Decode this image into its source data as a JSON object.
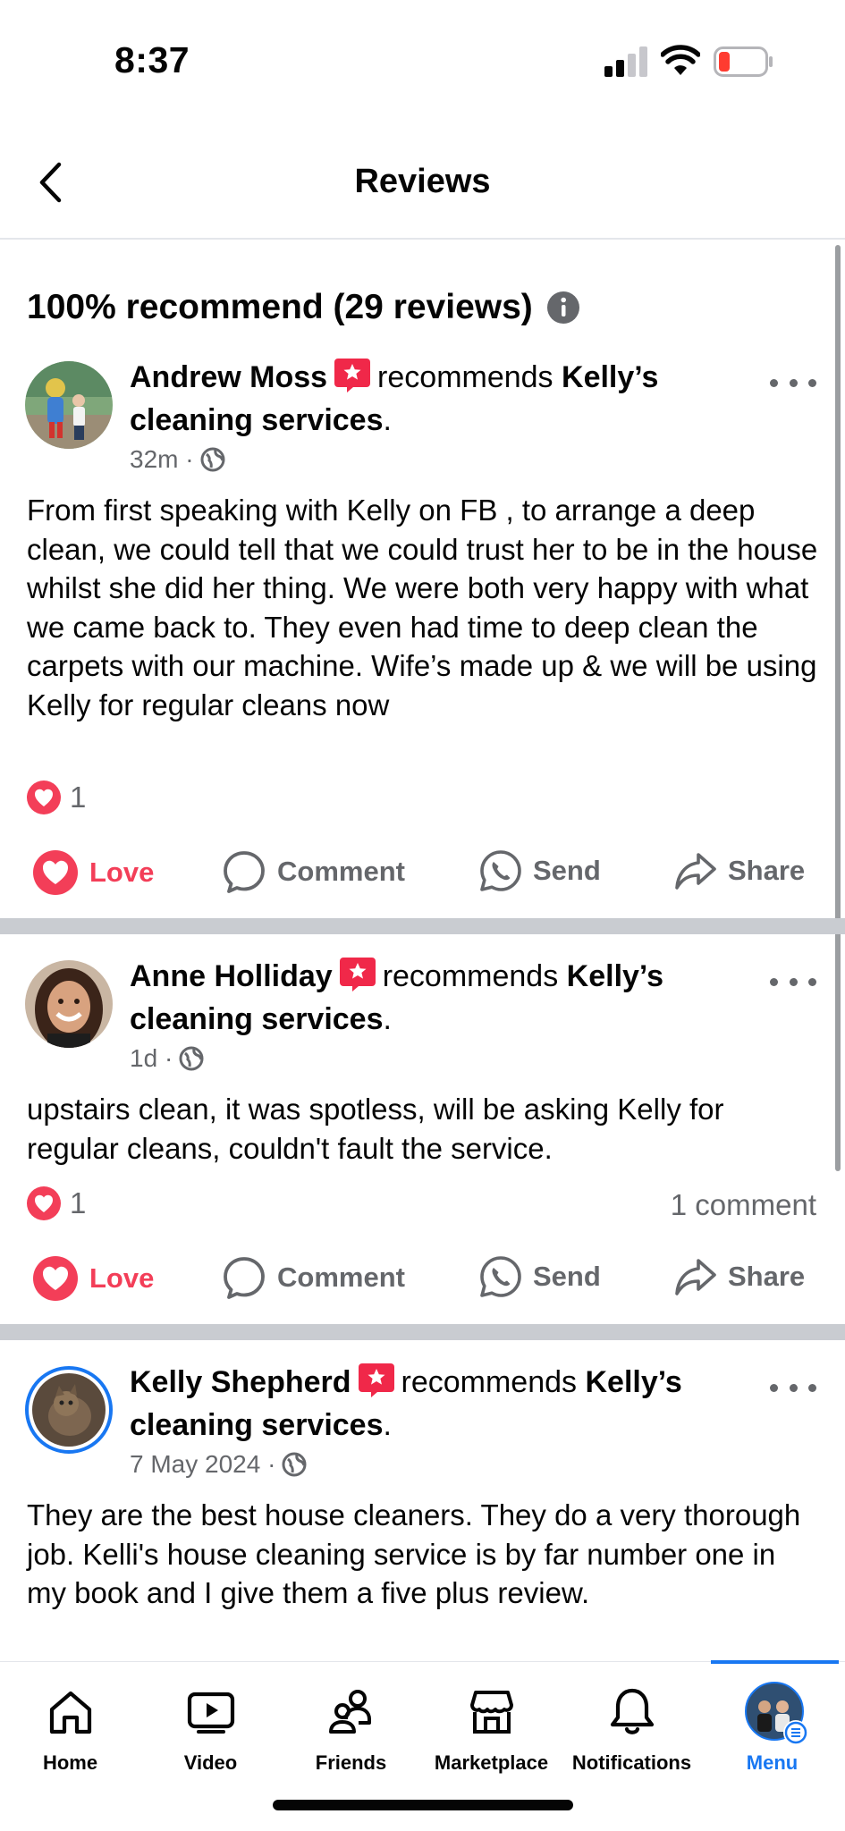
{
  "status_bar": {
    "time": "8:37"
  },
  "header": {
    "title": "Reviews"
  },
  "summary": {
    "text": "100% recommend (29 reviews)"
  },
  "reviews": [
    {
      "author": "Andrew Moss",
      "verb": "recommends",
      "page_name": "Kelly’s cleaning services",
      "period": ".",
      "time": "32m",
      "sep": "·",
      "text": "From first speaking with Kelly on FB , to arrange a deep clean, we could tell that we could trust her to be in the house whilst she did her thing. We were both very happy with what we came back to. They even had time to deep clean the carpets with our machine. Wife’s made up & we will be using Kelly for regular cleans now",
      "reactions": "1",
      "comments": ""
    },
    {
      "author": "Anne Holliday",
      "verb": "recommends",
      "page_name": "Kelly’s cleaning services",
      "period": ".",
      "time": "1d",
      "sep": "·",
      "text": "upstairs clean, it was spotless, will be asking Kelly for regular cleans, couldn't fault the service.",
      "reactions": "1",
      "comments": "1 comment"
    },
    {
      "author": "Kelly Shepherd",
      "verb": "recommends",
      "page_name": "Kelly’s cleaning services",
      "period": ".",
      "time": "7 May 2024",
      "sep": "·",
      "text": "They are the best house cleaners. They do a very thorough job. Kelli's house cleaning service is by far number one in my book and I give them a five plus review.",
      "reactions": "",
      "comments": ""
    }
  ],
  "actions": {
    "love": "Love",
    "comment": "Comment",
    "send": "Send",
    "share": "Share"
  },
  "nav": {
    "home": "Home",
    "video": "Video",
    "friends": "Friends",
    "marketplace": "Marketplace",
    "notifications": "Notifications",
    "menu": "Menu"
  },
  "colors": {
    "accent": "#1877f2",
    "love": "#f33e58",
    "badge": "#f02849",
    "secondary_text": "#65676b"
  },
  "icons": [
    "back-icon",
    "info-icon",
    "star-badge-icon",
    "globe-icon",
    "more-icon",
    "heart-icon",
    "comment-icon",
    "whatsapp-icon",
    "share-icon",
    "home-icon",
    "video-icon",
    "friends-icon",
    "marketplace-icon",
    "bell-icon"
  ]
}
